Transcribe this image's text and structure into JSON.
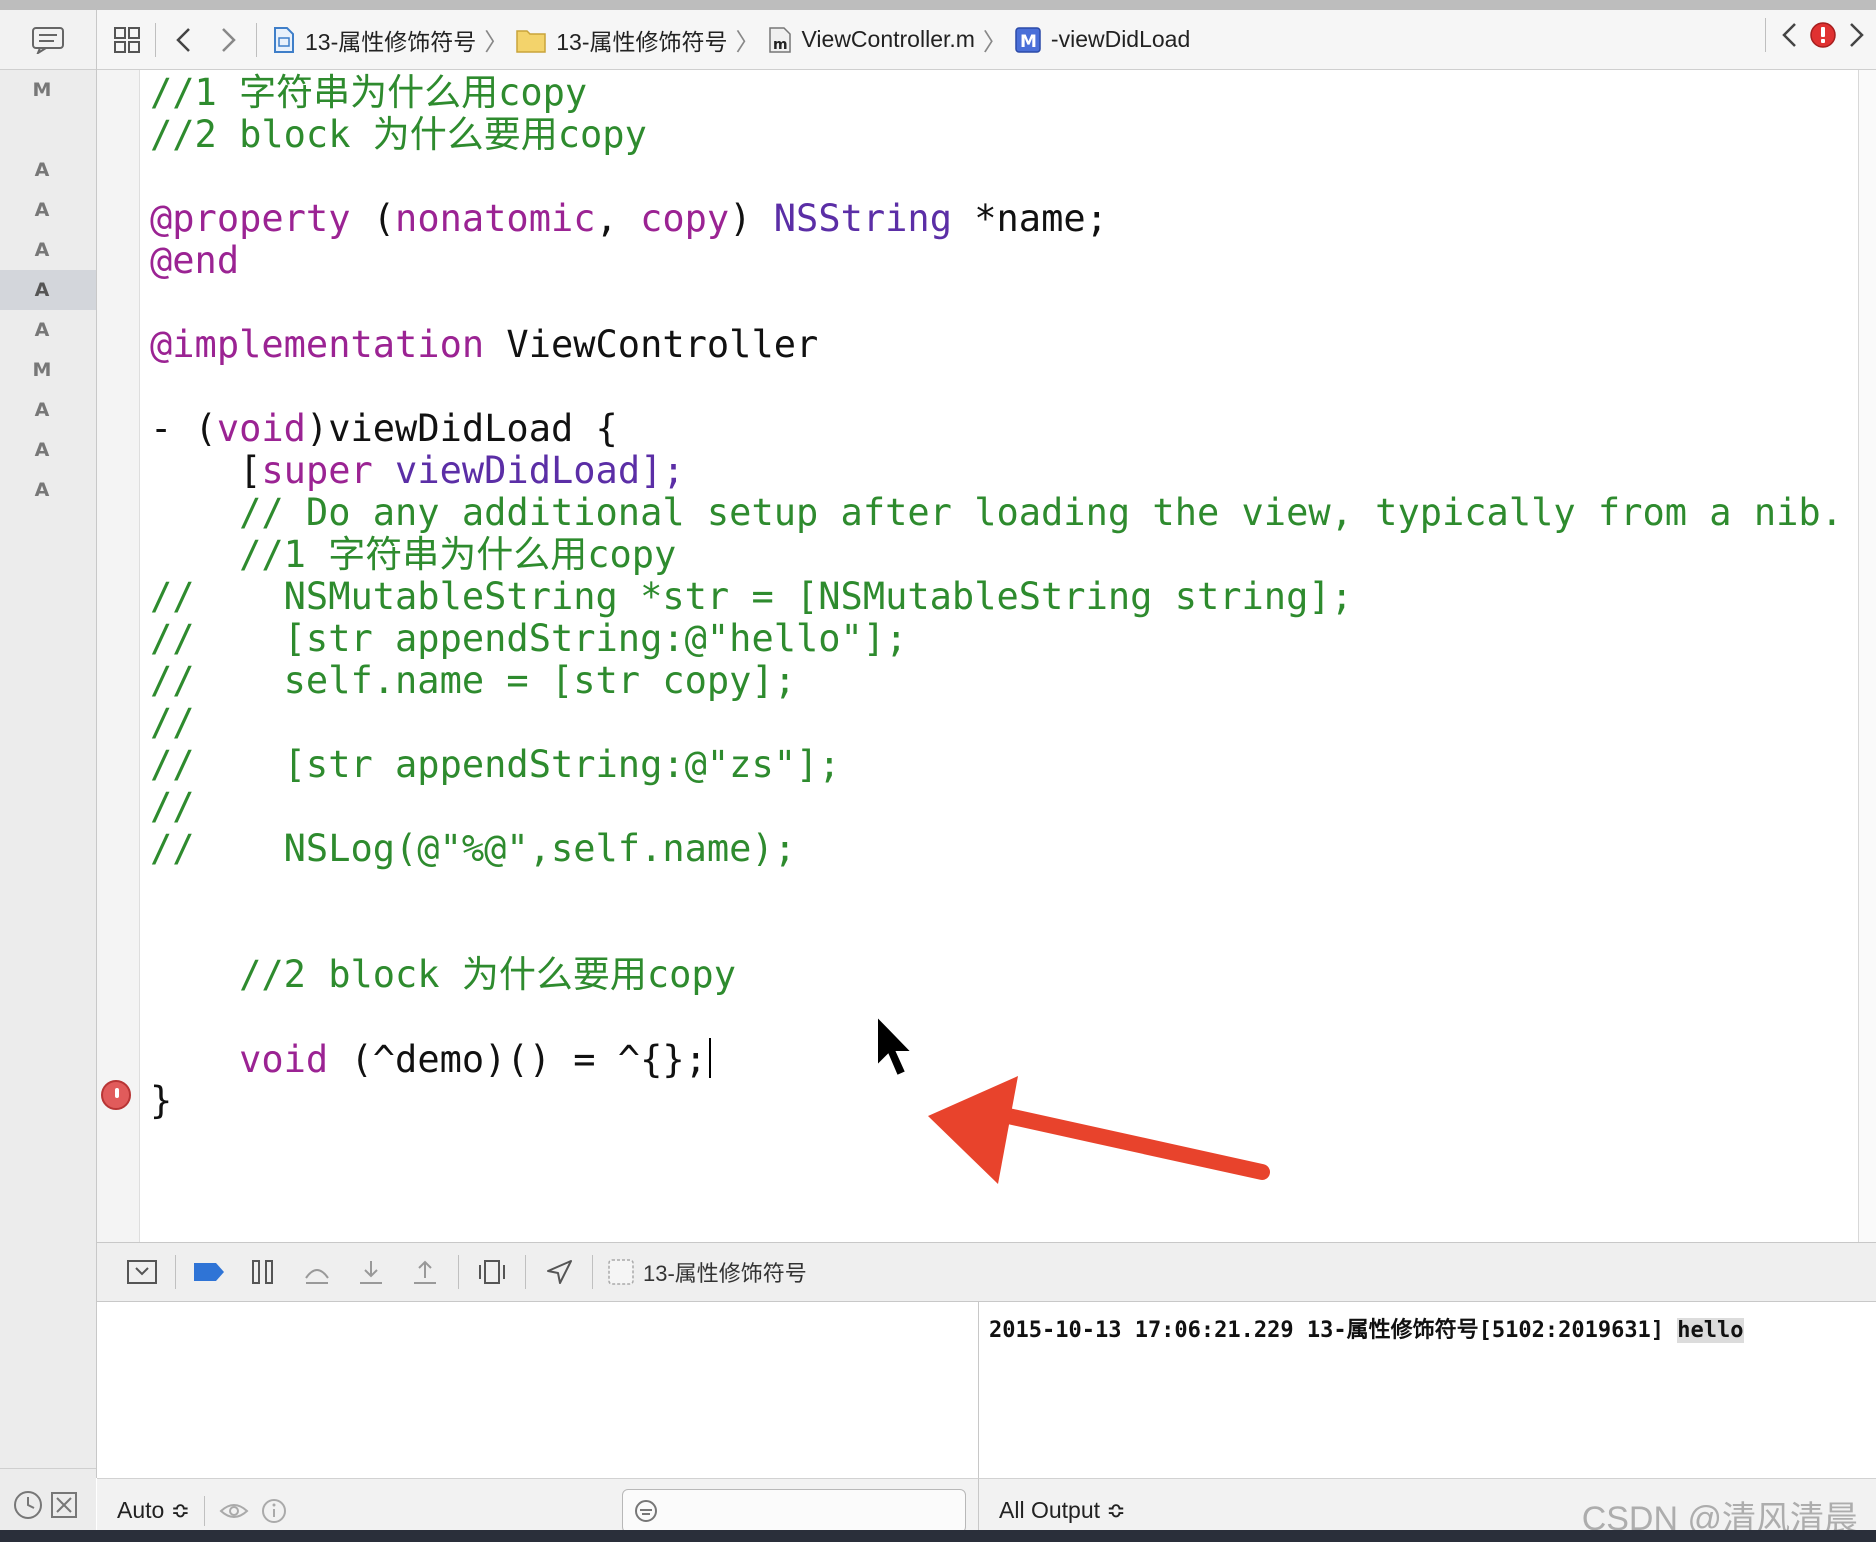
{
  "jumpbar": {
    "crumbs": [
      "13-属性修饰符号",
      "13-属性修饰符号",
      "ViewController.m",
      "-viewDidLoad"
    ]
  },
  "sidebar": {
    "statuses": [
      "M",
      "",
      "A",
      "A",
      "A",
      "A",
      "A",
      "M",
      "A",
      "A",
      "A"
    ],
    "selected_index": 5
  },
  "code": {
    "l1": "//1 字符串为什么用copy",
    "l2": "//2 block 为什么要用copy",
    "l4_kw": "@property",
    "l4_open": " (",
    "l4_attr1": "nonatomic",
    "l4_comma": ", ",
    "l4_attr2": "copy",
    "l4_close": ") ",
    "l4_type": "NSString",
    "l4_rest": " *name;",
    "l5": "@end",
    "l7_kw": "@implementation",
    "l7_rest": " ViewController",
    "l9_a": "- (",
    "l9_kw": "void",
    "l9_b": ")viewDidLoad {",
    "l10_a": "    [",
    "l10_kw": "super",
    "l10_b": " viewDidLoad];",
    "l11": "    // Do any additional setup after loading the view, typically from a nib.",
    "l12": "    //1 字符串为什么用copy",
    "l13": "//    NSMutableString *str = [NSMutableString string];",
    "l14": "//    [str appendString:@\"hello\"];",
    "l15": "//    self.name = [str copy];",
    "l16": "//",
    "l17": "//    [str appendString:@\"zs\"];",
    "l18": "//",
    "l19": "//    NSLog(@\"%@\",self.name);",
    "l22": "    //2 block 为什么要用copy",
    "l24_a": "    ",
    "l24_kw": "void",
    "l24_b": " (^demo)() = ^{};",
    "l25": "}"
  },
  "debug_bar": {
    "target": "13-属性修饰符号"
  },
  "variables": {
    "scope": "Auto ≎"
  },
  "console": {
    "log_prefix": "2015-10-13 17:06:21.229 13-属性修饰符号[5102:2019631] ",
    "log_value": "hello",
    "output_filter": "All Output ≎"
  },
  "watermark": "CSDN @清风清晨",
  "colors": {
    "comment": "#2e8b2e",
    "keyword": "#9b2393",
    "type": "#5b2ea6",
    "annotation_arrow": "#e8432c"
  }
}
